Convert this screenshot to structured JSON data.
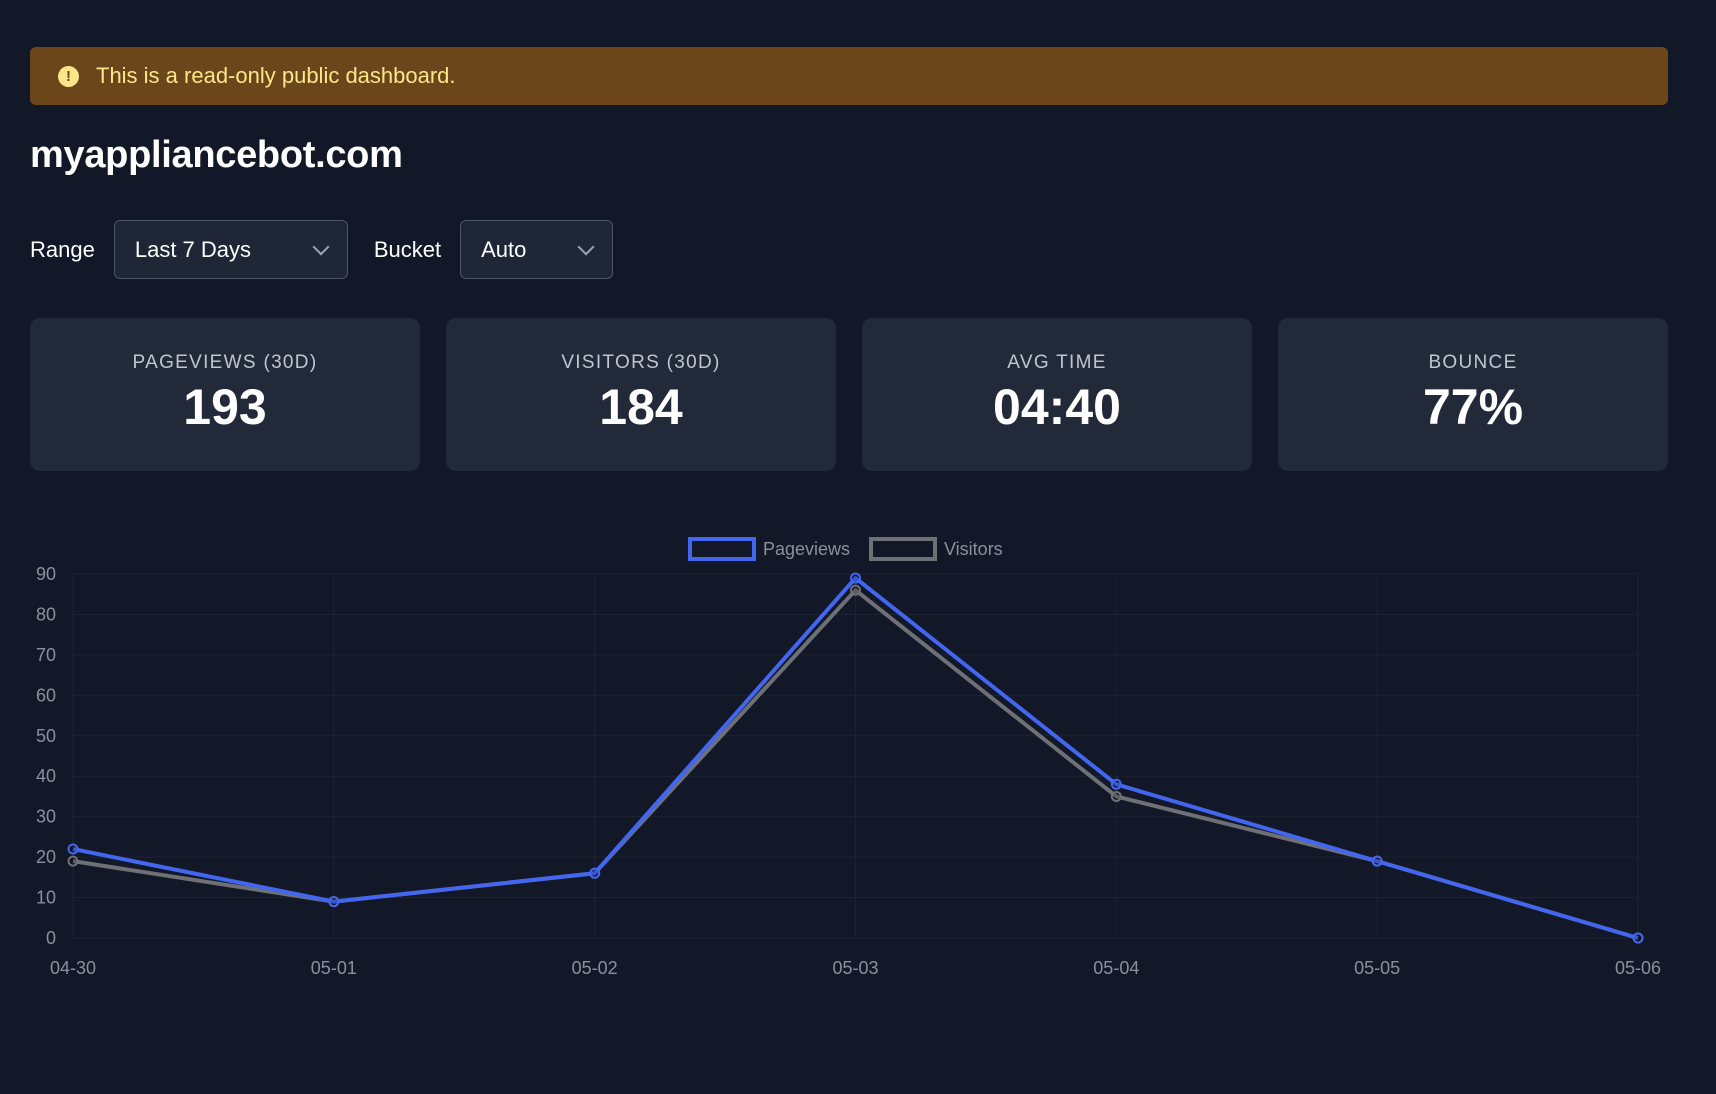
{
  "banner": {
    "icon": "exclamation-icon",
    "text": "This is a read-only public dashboard."
  },
  "site": {
    "title": "myappliancebot.com"
  },
  "controls": {
    "range_label": "Range",
    "range_value": "Last 7 Days",
    "bucket_label": "Bucket",
    "bucket_value": "Auto"
  },
  "stats": [
    {
      "label": "PAGEVIEWS (30D)",
      "value": "193"
    },
    {
      "label": "VISITORS (30D)",
      "value": "184"
    },
    {
      "label": "AVG TIME",
      "value": "04:40"
    },
    {
      "label": "BOUNCE",
      "value": "77%"
    }
  ],
  "colors": {
    "background": "#121827",
    "banner": "#6b461b",
    "pageviews": "#4366f0",
    "visitors": "#6e7076"
  },
  "chart_data": {
    "type": "line",
    "x": [
      "04-30",
      "05-01",
      "05-02",
      "05-03",
      "05-04",
      "05-05",
      "05-06"
    ],
    "series": [
      {
        "name": "Pageviews",
        "values": [
          22,
          9,
          16,
          89,
          38,
          19,
          0
        ]
      },
      {
        "name": "Visitors",
        "values": [
          19,
          9,
          16,
          86,
          35,
          19,
          0
        ]
      }
    ],
    "ylim": [
      0,
      90
    ],
    "yticks": [
      0,
      10,
      20,
      30,
      40,
      50,
      60,
      70,
      80,
      90
    ],
    "grid": true,
    "legend": "top-center"
  }
}
